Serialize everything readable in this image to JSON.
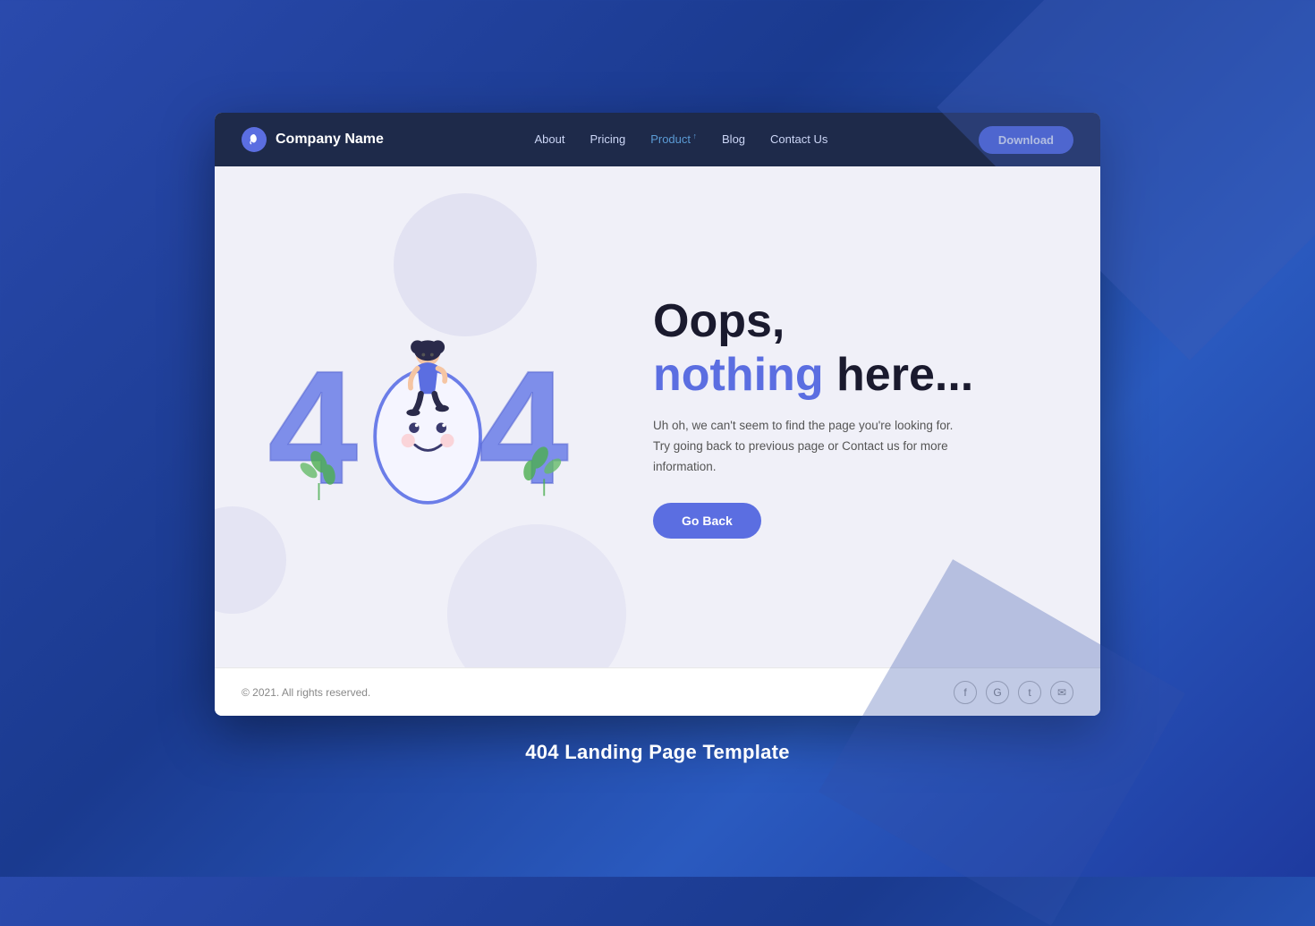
{
  "background": {
    "color_start": "#2a4aad",
    "color_end": "#1e3a9f"
  },
  "navbar": {
    "brand_name": "Company Name",
    "logo_icon": "leaf-icon",
    "nav_items": [
      {
        "label": "About",
        "active": false
      },
      {
        "label": "Pricing",
        "active": false
      },
      {
        "label": "Product",
        "active": true,
        "has_arrow": true
      },
      {
        "label": "Blog",
        "active": false
      },
      {
        "label": "Contact Us",
        "active": false
      }
    ],
    "download_label": "Download"
  },
  "main": {
    "oops_line1": "Oops,",
    "nothing_word": "nothing",
    "here_word": "here...",
    "description_line1": "Uh oh, we can't seem to find the page you're looking for.",
    "description_line2": "Try going back to previous page or Contact us for more information.",
    "go_back_label": "Go Back",
    "error_code": "404"
  },
  "footer": {
    "copyright": "© 2021. All rights reserved.",
    "social_icons": [
      {
        "name": "facebook-icon",
        "symbol": "f"
      },
      {
        "name": "google-icon",
        "symbol": "G"
      },
      {
        "name": "twitter-icon",
        "symbol": "t"
      },
      {
        "name": "email-icon",
        "symbol": "✉"
      }
    ]
  },
  "page_label": "404 Landing Page Template"
}
